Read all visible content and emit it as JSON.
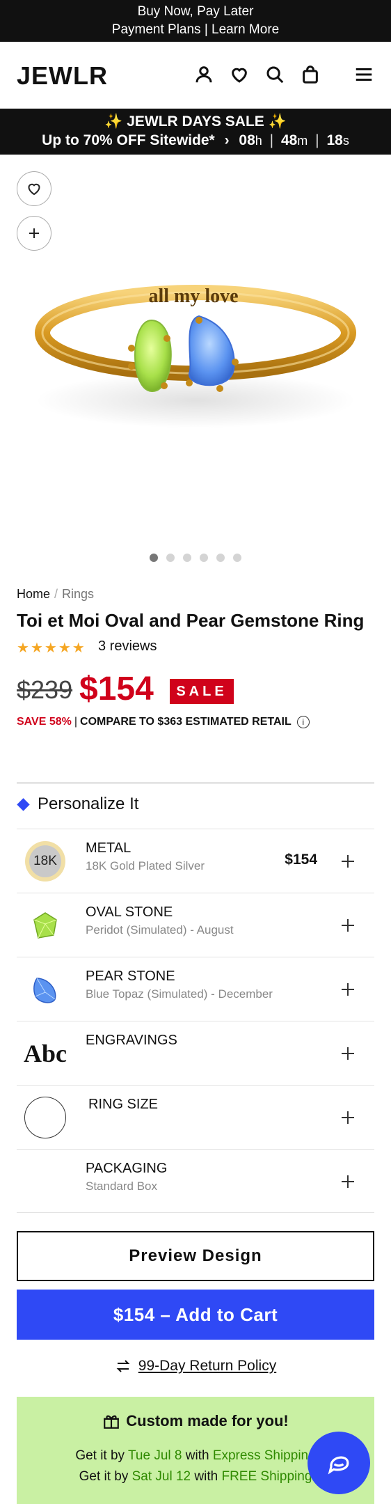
{
  "topbar": {
    "line1": "Buy Now, Pay Later",
    "line2": "Payment Plans | Learn More"
  },
  "header": {
    "logo": "JEWLR",
    "icons": [
      "account-icon",
      "heart-icon",
      "search-icon",
      "bag-icon",
      "menu-icon"
    ]
  },
  "sale_banner": {
    "title": "✨ JEWLR DAYS SALE ✨",
    "subtitle": "Up to 70% OFF Sitewide*",
    "countdown": {
      "hours": "08",
      "hours_unit": "h",
      "minutes": "48",
      "minutes_unit": "m",
      "seconds": "18",
      "seconds_unit": "s"
    }
  },
  "gallery": {
    "engraving": "all my love",
    "image_count": 6,
    "active_index": 0
  },
  "breadcrumb": {
    "home": "Home",
    "separator": "/",
    "current": "Rings"
  },
  "product": {
    "title": "Toi et Moi Oval and Pear Gemstone Ring",
    "rating": 5,
    "reviews": "3 reviews",
    "old_price": "$239",
    "price": "$154",
    "sale_badge": "SALE",
    "save": "SAVE 58%",
    "compare_sep": "|",
    "compare": "COMPARE TO $363 ESTIMATED RETAIL",
    "info_glyph": "i"
  },
  "personalize": {
    "title": "Personalize It",
    "options": [
      {
        "name": "METAL",
        "value": "18K Gold Plated Silver",
        "price": "$154",
        "badge": "18K"
      },
      {
        "name": "OVAL STONE",
        "value": "Peridot (Simulated) - August",
        "price": ""
      },
      {
        "name": "PEAR STONE",
        "value": "Blue Topaz (Simulated) - December",
        "price": ""
      },
      {
        "name": "ENGRAVINGS",
        "value": "",
        "price": "",
        "badge": "Abc"
      },
      {
        "name": "RING SIZE",
        "value": "",
        "price": ""
      },
      {
        "name": "PACKAGING",
        "value": "Standard Box",
        "price": ""
      }
    ]
  },
  "actions": {
    "preview": "Preview Design",
    "add_to_cart": "$154 – Add to Cart",
    "return_policy": "99-Day Return Policy"
  },
  "custom_made": {
    "title": "Custom made for you!",
    "line1_prefix": "Get it by",
    "line1_date": "Tue Jul 8",
    "line1_mid": "with",
    "line1_method": "Express Shipping",
    "line2_prefix": "Get it by",
    "line2_date": "Sat Jul 12",
    "line2_mid": "with",
    "line2_method": "FREE Shipping"
  },
  "colors": {
    "accent": "#2f49f5",
    "sale_red": "#d0021b",
    "ship_green": "#2f8a00",
    "promo_bg": "#c9f0a3",
    "star": "#f5a623"
  }
}
